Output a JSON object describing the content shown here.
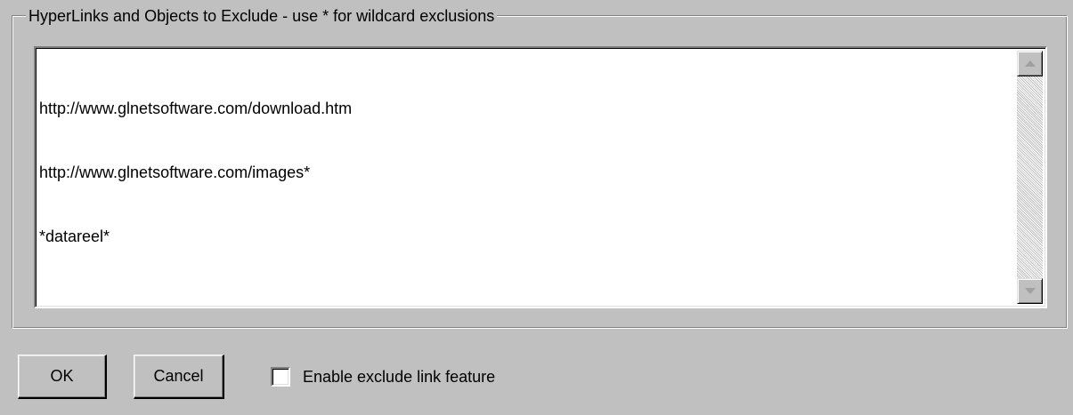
{
  "groupbox": {
    "title": "HyperLinks and Objects to Exclude - use * for wildcard exclusions"
  },
  "exclusions": {
    "lines": [
      "http://www.glnetsoftware.com/download.htm",
      "http://www.glnetsoftware.com/images*",
      "*datareel*"
    ]
  },
  "scrollbar": {
    "up_icon": "arrow-up-icon",
    "down_icon": "arrow-down-icon"
  },
  "buttons": {
    "ok_label": "OK",
    "cancel_label": "Cancel"
  },
  "feature_toggle": {
    "label": "Enable exclude link feature",
    "checked": false
  }
}
